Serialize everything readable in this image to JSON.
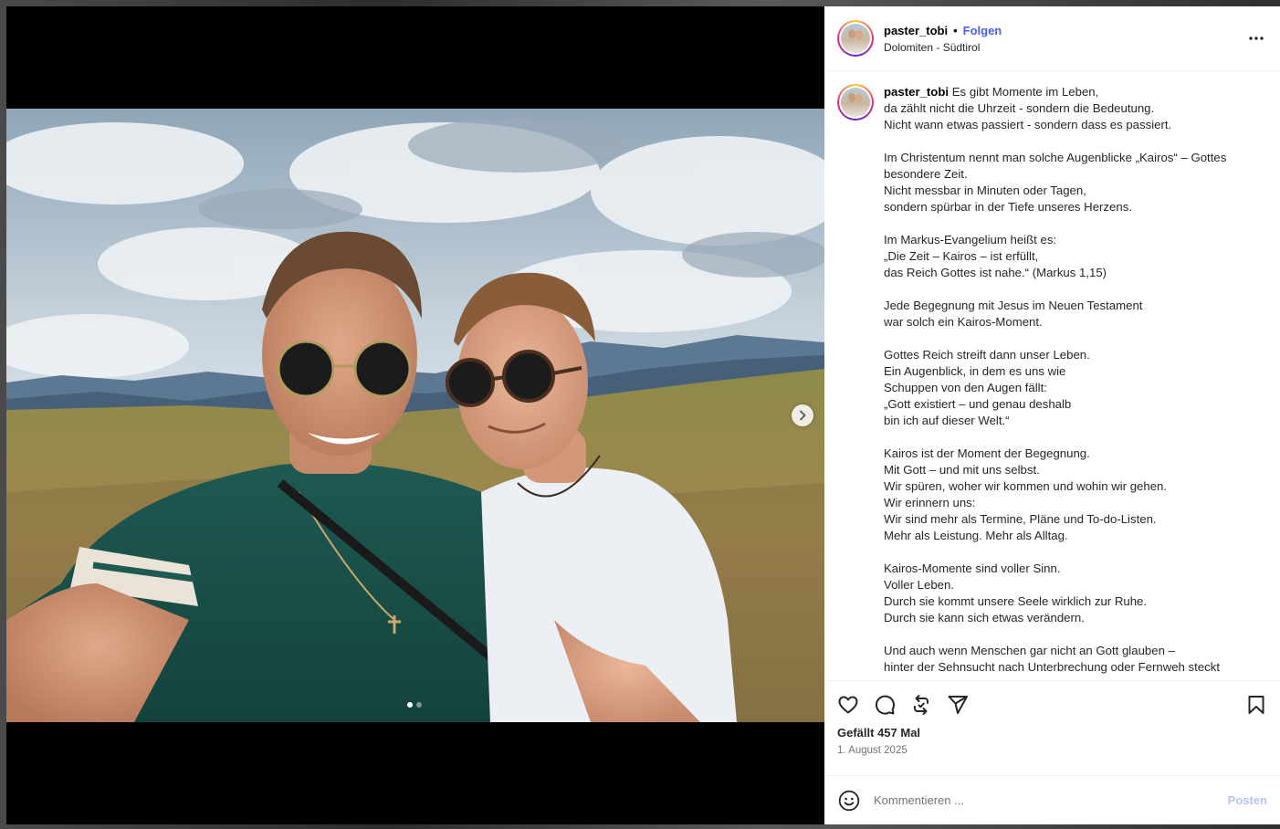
{
  "post": {
    "username": "paster_tobi",
    "separator": "•",
    "follow_label": "Folgen",
    "location": "Dolomiten - Südtirol",
    "caption": "Es gibt Momente im Leben,\nda zählt nicht die Uhrzeit - sondern die Bedeutung.\nNicht wann etwas passiert - sondern dass es passiert.\n\nIm Christentum nennt man solche Augenblicke „Kairos“ – Gottes besondere Zeit.\nNicht messbar in Minuten oder Tagen,\nsondern spürbar in der Tiefe unseres Herzens.\n\nIm Markus-Evangelium heißt es:\n„Die Zeit – Kairos – ist erfüllt,\ndas Reich Gottes ist nahe.“ (Markus 1,15)\n\nJede Begegnung mit Jesus im Neuen Testament\nwar solch ein Kairos-Moment.\n\nGottes Reich streift dann unser Leben.\nEin Augenblick, in dem es uns wie\nSchuppen von den Augen fällt:\n„Gott existiert – und genau deshalb\nbin ich auf dieser Welt.“\n\nKairos ist der Moment der Begegnung.\nMit Gott – und mit uns selbst.\nWir spüren, woher wir kommen und wohin wir gehen.\nWir erinnern uns:\nWir sind mehr als Termine, Pläne und To-do-Listen.\nMehr als Leistung. Mehr als Alltag.\n\nKairos-Momente sind voller Sinn.\nVoller Leben.\nDurch sie kommt unsere Seele wirklich zur Ruhe.\nDurch sie kann sich etwas verändern.\n\nUnd auch wenn Menschen gar nicht an Gott glauben –\nhinter der Sehnsucht nach Unterbrechung oder Fernweh steckt",
    "likes": "Gefällt 457 Mal",
    "date": "1. August 2025",
    "carousel": {
      "current": 1,
      "total": 2
    }
  },
  "comment": {
    "placeholder": "Kommentieren ...",
    "post_label": "Posten"
  },
  "icons": {
    "more": "more-horizontal-icon",
    "like": "heart-icon",
    "comment": "comment-icon",
    "repost": "repost-icon",
    "share": "send-icon",
    "save": "bookmark-icon",
    "emoji": "emoji-icon",
    "next": "chevron-right-icon"
  },
  "colors": {
    "follow": "#4a5df9",
    "post_button": "#b3c4f5"
  }
}
